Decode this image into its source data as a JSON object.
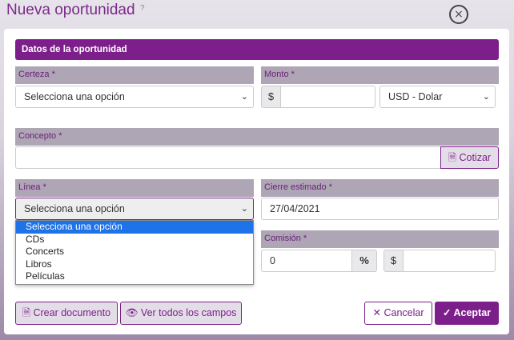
{
  "header": {
    "title": "Nueva oportunidad",
    "help": "?",
    "close": "×"
  },
  "section": {
    "title": "Datos de la oportunidad"
  },
  "certeza": {
    "label": "Certeza *",
    "value": "Selecciona una opción"
  },
  "monto": {
    "label": "Monto *",
    "prefix": "$",
    "value": "",
    "currency": "USD - Dolar"
  },
  "concepto": {
    "label": "Concepto *",
    "value": "",
    "cotizar": "Cotizar"
  },
  "linea": {
    "label": "Línea *",
    "value": "Selecciona una opción",
    "options": [
      "Selecciona una opción",
      "CDs",
      "Concerts",
      "Libros",
      "Películas"
    ]
  },
  "cierre": {
    "label": "Cierre estimado *",
    "value": "27/04/2021"
  },
  "comision": {
    "label": "Comisión *",
    "value": "0",
    "percent": "%",
    "prefix": "$",
    "amount": ""
  },
  "actions": {
    "crear": "Crear documento",
    "ver": "Ver todos los campos",
    "cancelar": "Cancelar",
    "aceptar": "Aceptar"
  }
}
